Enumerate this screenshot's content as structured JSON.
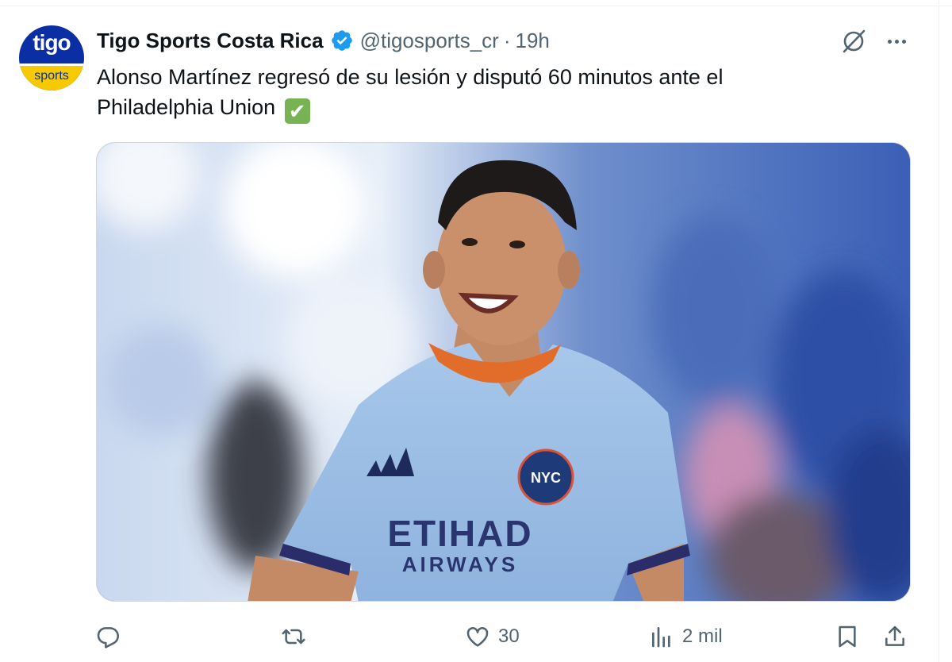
{
  "account": {
    "display_name": "Tigo Sports Costa Rica",
    "handle": "@tigosports_cr",
    "separator": "·",
    "time": "19h",
    "avatar_top": "tigo",
    "avatar_bottom": "sports"
  },
  "tweet": {
    "text_line1": "Alonso Martínez regresó de su lesión y disputó 60 minutos ante el",
    "text_line2": "Philadelphia Union",
    "emoji": "✔"
  },
  "media": {
    "jersey_sponsor_line1": "ETIHAD",
    "jersey_sponsor_line2": "AIRWAYS",
    "crest_text": "NYC"
  },
  "actions": {
    "reply_count": "",
    "repost_count": "",
    "like_count": "30",
    "views_count": "2 mil"
  },
  "colors": {
    "text_primary": "#0f1419",
    "text_secondary": "#536471",
    "verified_blue": "#1d9bf0",
    "border": "#cfd9de"
  },
  "icons": [
    "verified-badge-icon",
    "grok-icon",
    "more-icon",
    "reply-icon",
    "repost-icon",
    "like-icon",
    "views-icon",
    "bookmark-icon",
    "share-icon"
  ]
}
